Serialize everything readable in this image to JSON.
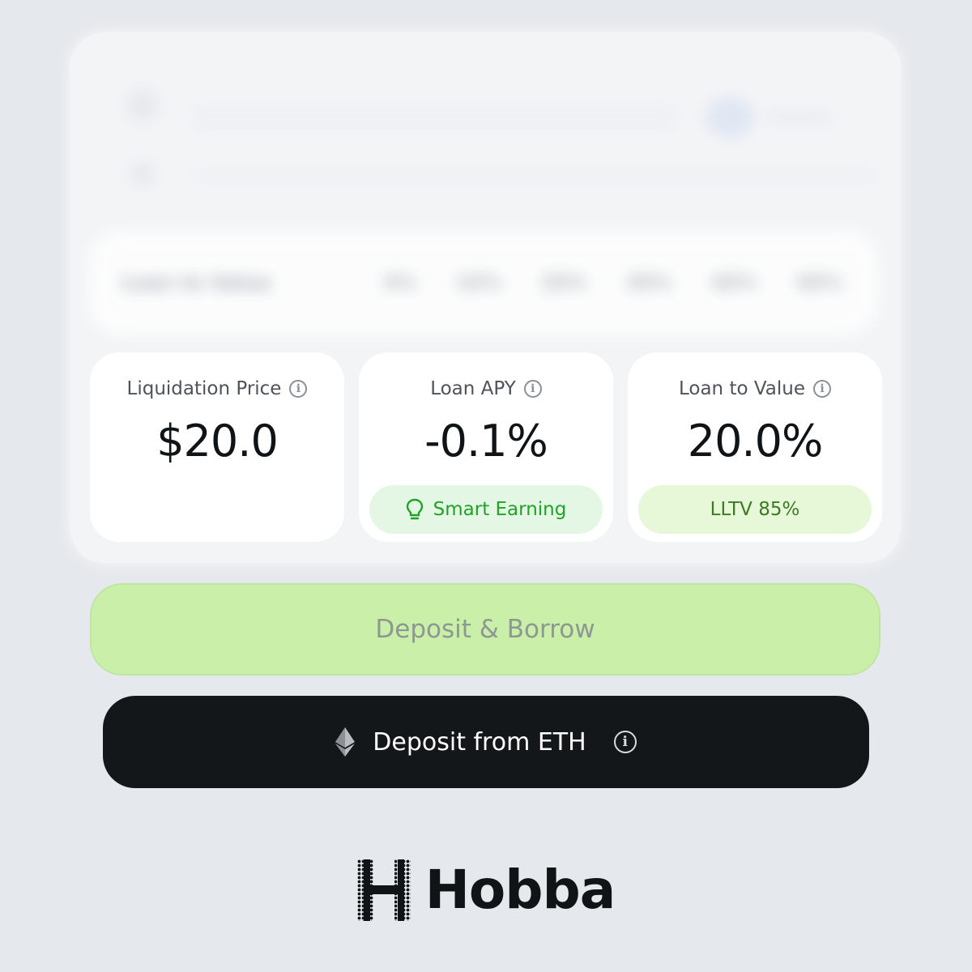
{
  "background_blur": {
    "label": "Loan to Value",
    "options": [
      "0%",
      "10%",
      "20%",
      "30%",
      "40%",
      "50%"
    ]
  },
  "cards": {
    "liquidation": {
      "title": "Liquidation Price",
      "value": "$20.0"
    },
    "apy": {
      "title": "Loan APY",
      "value": "-0.1%",
      "pill": "Smart Earning"
    },
    "ltv": {
      "title": "Loan to Value",
      "value": "20.0%",
      "pill": "LLTV 85%"
    }
  },
  "buttons": {
    "deposit_borrow": "Deposit & Borrow",
    "deposit_eth": "Deposit from ETH"
  },
  "brand": {
    "name": "Hobba"
  },
  "colors": {
    "background": "#e5e8ec",
    "primary_button": "#c9efa9",
    "dark_button": "#141719",
    "earning_green": "#20a327"
  },
  "icons": [
    "info-icon",
    "lightbulb-icon",
    "ethereum-icon",
    "hobba-logo-icon"
  ]
}
